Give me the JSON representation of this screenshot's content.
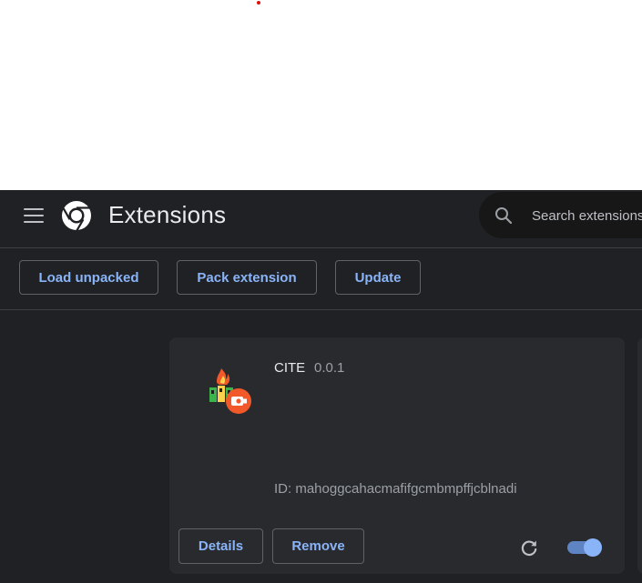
{
  "header": {
    "title": "Extensions",
    "search_placeholder": "Search extensions"
  },
  "toolbar": {
    "load_unpacked_label": "Load unpacked",
    "pack_extension_label": "Pack extension",
    "update_label": "Update"
  },
  "extension": {
    "name": "CITE",
    "version": "0.0.1",
    "id_label": "ID:",
    "id": "mahoggcahacmafifgcmbmpffjcblnadi",
    "details_label": "Details",
    "remove_label": "Remove",
    "enabled": true,
    "icon": "cite-extension-icon"
  },
  "colors": {
    "background": "#202124",
    "card": "#292a2d",
    "accent": "#8ab4f8",
    "text": "#e8eaed",
    "secondary_text": "#9aa0a6"
  },
  "icons": {
    "menu": "hamburger-menu-icon",
    "logo": "chrome-logo",
    "search": "search-icon",
    "reload": "reload-icon"
  }
}
